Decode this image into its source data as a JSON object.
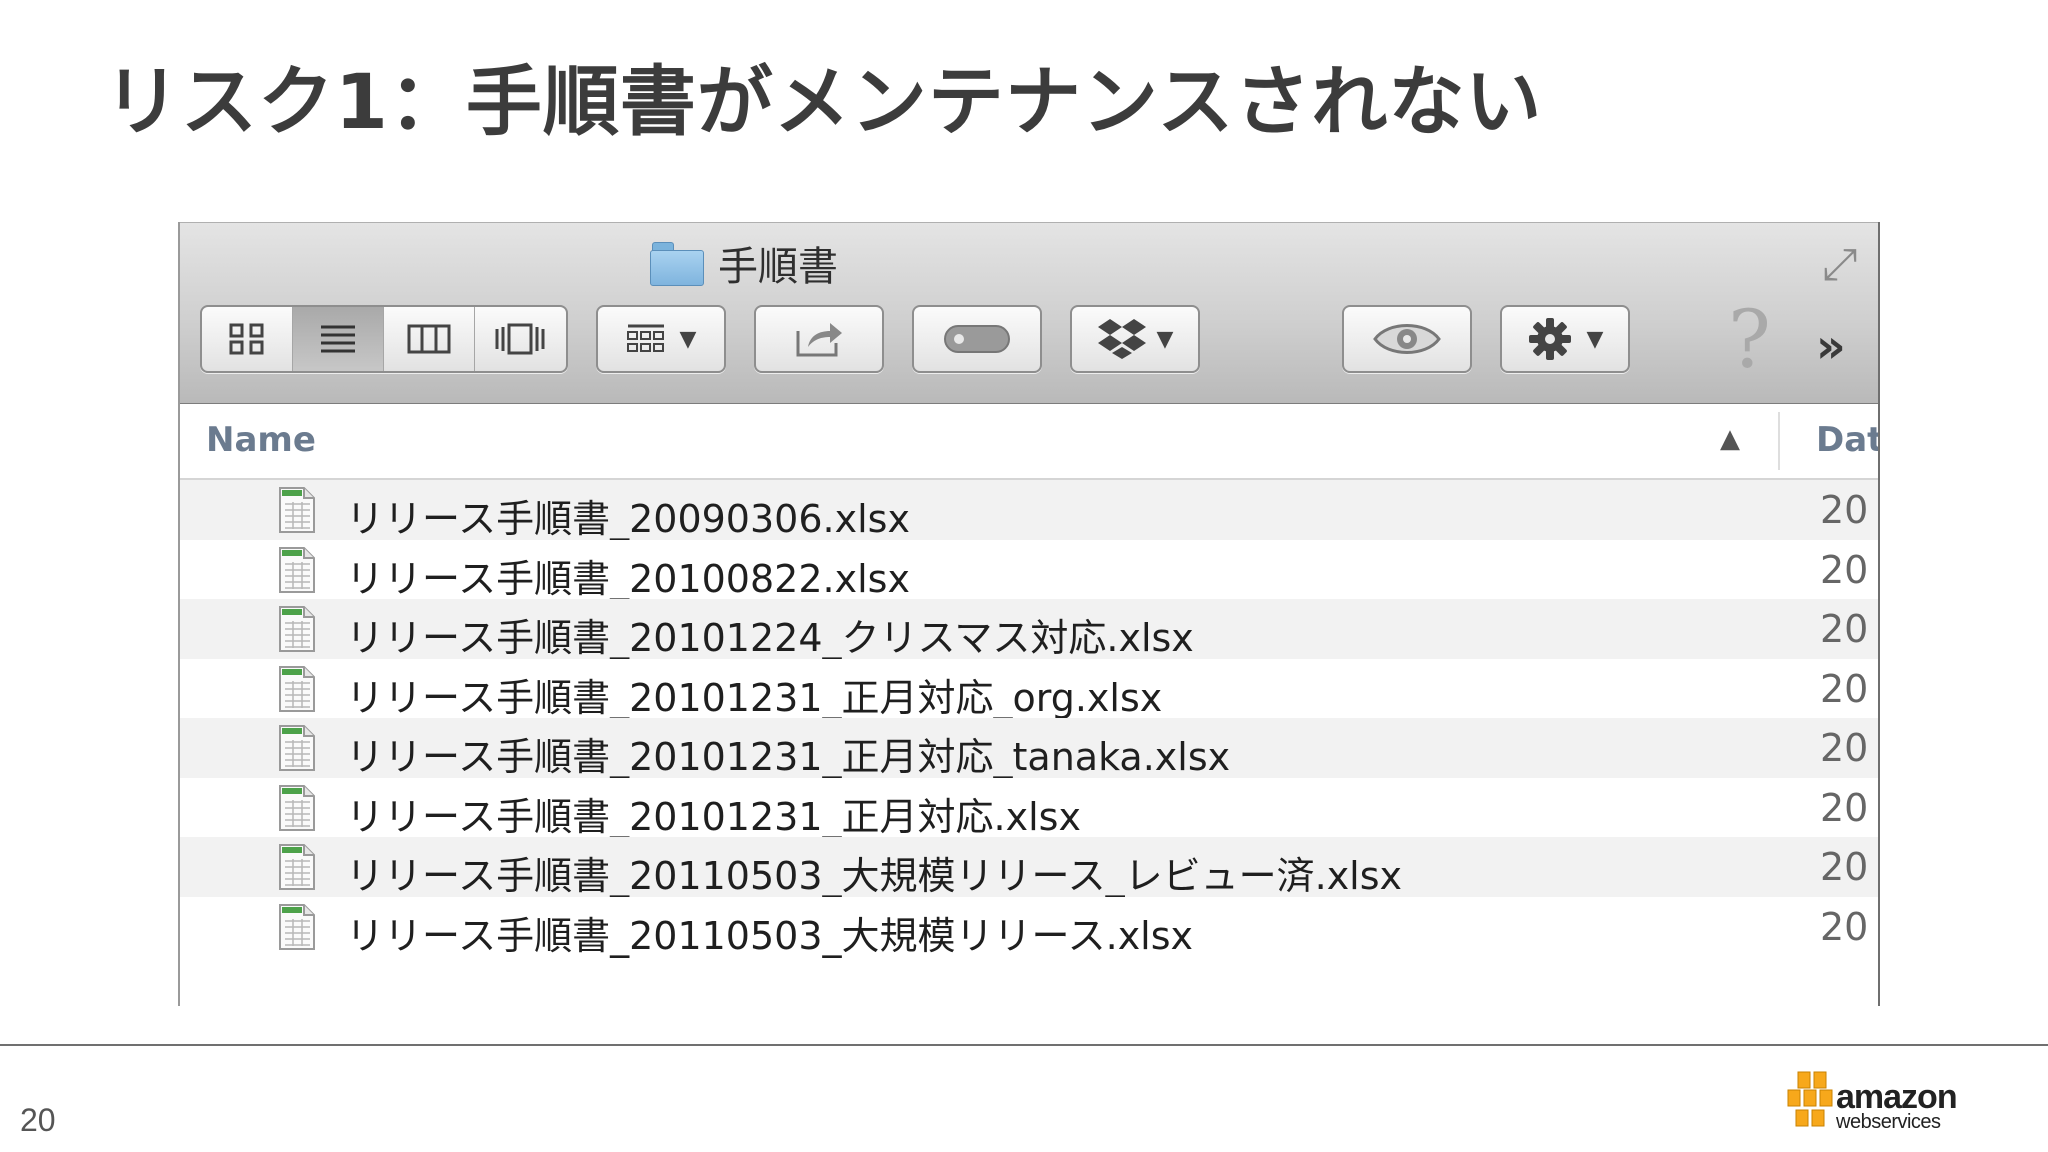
{
  "slide": {
    "title": "リスク1：手順書がメンテナンスされない",
    "page_number": "20"
  },
  "finder": {
    "window_title": "手順書",
    "toolbar": {
      "view_buttons": [
        "icon-view",
        "list-view",
        "column-view",
        "cover-flow-view"
      ],
      "active_view": "list-view",
      "help_glyph": "?",
      "more_glyph": "»"
    },
    "columns": {
      "name": "Name",
      "date": "Dat"
    },
    "files": [
      {
        "name": "リリース手順書_20090306.xlsx",
        "date": "20"
      },
      {
        "name": "リリース手順書_20100822.xlsx",
        "date": "20"
      },
      {
        "name": "リリース手順書_20101224_クリスマス対応.xlsx",
        "date": "20"
      },
      {
        "name": "リリース手順書_20101231_正月対応_org.xlsx",
        "date": "20"
      },
      {
        "name": "リリース手順書_20101231_正月対応_tanaka.xlsx",
        "date": "20"
      },
      {
        "name": "リリース手順書_20101231_正月対応.xlsx",
        "date": "20"
      },
      {
        "name": "リリース手順書_20110503_大規模リリース_レビュー済.xlsx",
        "date": "20"
      },
      {
        "name": "リリース手順書_20110503_大規模リリース.xlsx",
        "date": "20"
      }
    ]
  },
  "branding": {
    "word": "amazon",
    "sub": "webservices",
    "accent_color": "#f7a81b"
  }
}
